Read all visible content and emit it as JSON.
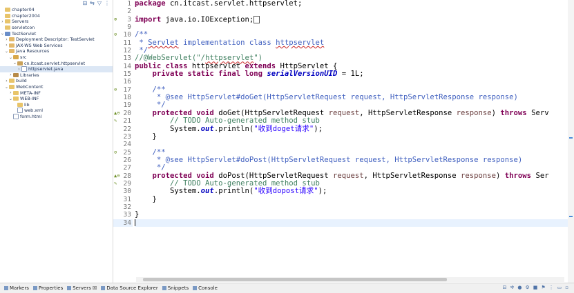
{
  "explorer": {
    "toolbar": [
      "⊟",
      "⇆",
      "▽",
      "⋮"
    ],
    "items": [
      {
        "label": "chapter04",
        "depth": 0,
        "twisty": "",
        "icon": "folder"
      },
      {
        "label": "chapter2004",
        "depth": 0,
        "twisty": "",
        "icon": "folder"
      },
      {
        "label": "Servers",
        "depth": 0,
        "twisty": "›",
        "icon": "folder"
      },
      {
        "label": "servletcon",
        "depth": 0,
        "twisty": "",
        "icon": "folder"
      },
      {
        "label": "TestServlet",
        "depth": 0,
        "twisty": "⌄",
        "icon": "project"
      },
      {
        "label": "Deployment Descriptor: TestServlet",
        "depth": 1,
        "twisty": "›",
        "icon": "java"
      },
      {
        "label": "JAX-WS Web Services",
        "depth": 1,
        "twisty": "›",
        "icon": "java"
      },
      {
        "label": "Java Resources",
        "depth": 1,
        "twisty": "⌄",
        "icon": "java"
      },
      {
        "label": "src",
        "depth": 2,
        "twisty": "⌄",
        "icon": "src"
      },
      {
        "label": "cn.itcast.servlet.httpservlet",
        "depth": 3,
        "twisty": "⌄",
        "icon": "pkg"
      },
      {
        "label": "httpservlet.java",
        "depth": 4,
        "twisty": "›",
        "icon": "file",
        "selected": true
      },
      {
        "label": "Libraries",
        "depth": 2,
        "twisty": "›",
        "icon": "lib"
      },
      {
        "label": "build",
        "depth": 1,
        "twisty": "›",
        "icon": "folder"
      },
      {
        "label": "WebContent",
        "depth": 1,
        "twisty": "⌄",
        "icon": "folder"
      },
      {
        "label": "META-INF",
        "depth": 2,
        "twisty": "›",
        "icon": "folder"
      },
      {
        "label": "WEB-INF",
        "depth": 2,
        "twisty": "⌄",
        "icon": "folder"
      },
      {
        "label": "lib",
        "depth": 3,
        "twisty": "",
        "icon": "folder"
      },
      {
        "label": "web.xml",
        "depth": 3,
        "twisty": "",
        "icon": "file"
      },
      {
        "label": "form.html",
        "depth": 2,
        "twisty": "",
        "icon": "file"
      }
    ]
  },
  "editor": {
    "lines": [
      {
        "num": "1",
        "mark": "",
        "tokens": [
          {
            "t": "package ",
            "c": "kw"
          },
          {
            "t": "cn.itcast.servlet.httpservlet;",
            "c": ""
          }
        ]
      },
      {
        "num": "2",
        "mark": "",
        "tokens": []
      },
      {
        "num": "3",
        "mark": "⊕",
        "tokens": [
          {
            "t": "import ",
            "c": "kw"
          },
          {
            "t": "java.io.IOException;",
            "c": ""
          },
          {
            "t": "",
            "c": "boxed"
          }
        ]
      },
      {
        "num": "9",
        "mark": "",
        "tokens": []
      },
      {
        "num": "10",
        "mark": "⊖",
        "tokens": [
          {
            "t": "/**",
            "c": "jd"
          }
        ]
      },
      {
        "num": "11",
        "mark": "",
        "tokens": [
          {
            "t": " * ",
            "c": "jd"
          },
          {
            "t": "Servlet",
            "c": "jd squig"
          },
          {
            "t": " implementation class ",
            "c": "jd"
          },
          {
            "t": "httpservlet",
            "c": "jd squig"
          }
        ]
      },
      {
        "num": "12",
        "mark": "",
        "tokens": [
          {
            "t": " */",
            "c": "jd"
          }
        ]
      },
      {
        "num": "13",
        "mark": "",
        "tokens": [
          {
            "t": "//@WebServlet(\"/",
            "c": "cm"
          },
          {
            "t": "httpservlet",
            "c": "cm squig"
          },
          {
            "t": "\")",
            "c": "cm"
          }
        ]
      },
      {
        "num": "14",
        "mark": "",
        "tokens": [
          {
            "t": "public class ",
            "c": "kw"
          },
          {
            "t": "httpservlet ",
            "c": ""
          },
          {
            "t": "extends ",
            "c": "kw"
          },
          {
            "t": "HttpServlet {",
            "c": ""
          }
        ]
      },
      {
        "num": "15",
        "mark": "",
        "tokens": [
          {
            "t": "    private static final long ",
            "c": "kw"
          },
          {
            "t": "serialVersionUID",
            "c": "fld"
          },
          {
            "t": " = 1L;",
            "c": ""
          }
        ]
      },
      {
        "num": "16",
        "mark": "",
        "tokens": []
      },
      {
        "num": "17",
        "mark": "⊖",
        "tokens": [
          {
            "t": "    /**",
            "c": "jd"
          }
        ]
      },
      {
        "num": "18",
        "mark": "",
        "tokens": [
          {
            "t": "     * @see HttpServlet#doGet(HttpServletRequest request, HttpServletResponse response)",
            "c": "jd"
          }
        ]
      },
      {
        "num": "19",
        "mark": "",
        "tokens": [
          {
            "t": "     */",
            "c": "jd"
          }
        ]
      },
      {
        "num": "20",
        "mark": "▲⊖",
        "tokens": [
          {
            "t": "    protected void ",
            "c": "kw"
          },
          {
            "t": "doGet(HttpServletRequest ",
            "c": ""
          },
          {
            "t": "request",
            "c": "param"
          },
          {
            "t": ", HttpServletResponse ",
            "c": ""
          },
          {
            "t": "response",
            "c": "param"
          },
          {
            "t": ") ",
            "c": ""
          },
          {
            "t": "throws ",
            "c": "kw"
          },
          {
            "t": "Serv",
            "c": ""
          }
        ]
      },
      {
        "num": "21",
        "mark": "✎",
        "tokens": [
          {
            "t": "        // TODO Auto-generated method stub",
            "c": "cm"
          }
        ]
      },
      {
        "num": "22",
        "mark": "",
        "tokens": [
          {
            "t": "        System.",
            "c": ""
          },
          {
            "t": "out",
            "c": "fld"
          },
          {
            "t": ".println(",
            "c": ""
          },
          {
            "t": "\"收到doget请求\"",
            "c": "str"
          },
          {
            "t": ");",
            "c": ""
          }
        ]
      },
      {
        "num": "23",
        "mark": "",
        "tokens": [
          {
            "t": "    }",
            "c": ""
          }
        ]
      },
      {
        "num": "24",
        "mark": "",
        "tokens": []
      },
      {
        "num": "25",
        "mark": "⊖",
        "tokens": [
          {
            "t": "    /**",
            "c": "jd"
          }
        ]
      },
      {
        "num": "26",
        "mark": "",
        "tokens": [
          {
            "t": "     * @see HttpServlet#doPost(HttpServletRequest request, HttpServletResponse response)",
            "c": "jd"
          }
        ]
      },
      {
        "num": "27",
        "mark": "",
        "tokens": [
          {
            "t": "     */",
            "c": "jd"
          }
        ]
      },
      {
        "num": "28",
        "mark": "▲⊖",
        "tokens": [
          {
            "t": "    protected void ",
            "c": "kw"
          },
          {
            "t": "doPost(HttpServletRequest ",
            "c": ""
          },
          {
            "t": "request",
            "c": "param"
          },
          {
            "t": ", HttpServletResponse ",
            "c": ""
          },
          {
            "t": "response",
            "c": "param"
          },
          {
            "t": ") ",
            "c": ""
          },
          {
            "t": "throws ",
            "c": "kw"
          },
          {
            "t": "Ser",
            "c": ""
          }
        ]
      },
      {
        "num": "29",
        "mark": "✎",
        "tokens": [
          {
            "t": "        // TODO Auto-generated method stub",
            "c": "cm"
          }
        ]
      },
      {
        "num": "30",
        "mark": "",
        "tokens": [
          {
            "t": "        System.",
            "c": ""
          },
          {
            "t": "out",
            "c": "fld"
          },
          {
            "t": ".println(",
            "c": ""
          },
          {
            "t": "\"收到dopost请求\"",
            "c": "str"
          },
          {
            "t": ");",
            "c": ""
          }
        ]
      },
      {
        "num": "31",
        "mark": "",
        "tokens": [
          {
            "t": "    }",
            "c": ""
          }
        ]
      },
      {
        "num": "32",
        "mark": "",
        "tokens": []
      },
      {
        "num": "33",
        "mark": "",
        "tokens": [
          {
            "t": "}",
            "c": ""
          }
        ]
      },
      {
        "num": "34",
        "mark": "",
        "tokens": [],
        "current": true
      }
    ]
  },
  "bottom_tabs": [
    {
      "label": "Markers",
      "icon": "markers-icon"
    },
    {
      "label": "Properties",
      "icon": "properties-icon"
    },
    {
      "label": "Servers ☒",
      "icon": "servers-icon"
    },
    {
      "label": "Data Source Explorer",
      "icon": "data-source-icon"
    },
    {
      "label": "Snippets",
      "icon": "snippets-icon"
    },
    {
      "label": "Console",
      "icon": "console-icon"
    }
  ],
  "bottom_toolbar": [
    "⊟",
    "✲",
    "●",
    "⚙",
    "■",
    "⚑",
    "⋮",
    "▭",
    "▫"
  ],
  "colors": {
    "keyword": "#7f0055",
    "comment": "#3f7f5f",
    "javadoc": "#3f5fbf",
    "string": "#2a00ff",
    "field": "#0000c0"
  }
}
